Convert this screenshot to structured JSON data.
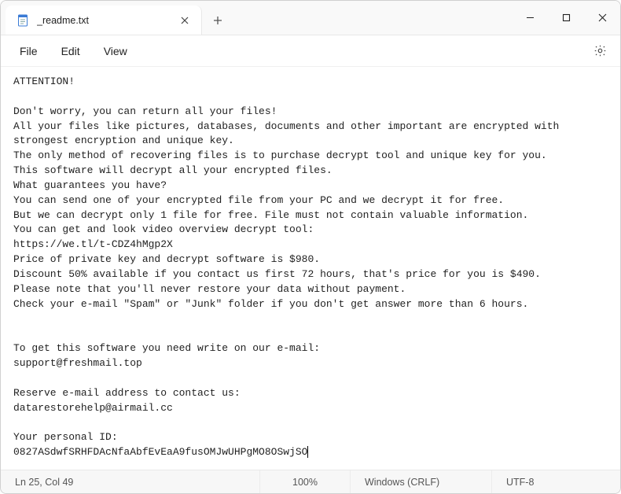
{
  "titlebar": {
    "tab_title": "_readme.txt"
  },
  "menubar": {
    "file": "File",
    "edit": "Edit",
    "view": "View"
  },
  "document": {
    "text": "ATTENTION!\n\nDon't worry, you can return all your files!\nAll your files like pictures, databases, documents and other important are encrypted with strongest encryption and unique key.\nThe only method of recovering files is to purchase decrypt tool and unique key for you.\nThis software will decrypt all your encrypted files.\nWhat guarantees you have?\nYou can send one of your encrypted file from your PC and we decrypt it for free.\nBut we can decrypt only 1 file for free. File must not contain valuable information.\nYou can get and look video overview decrypt tool:\nhttps://we.tl/t-CDZ4hMgp2X\nPrice of private key and decrypt software is $980.\nDiscount 50% available if you contact us first 72 hours, that's price for you is $490.\nPlease note that you'll never restore your data without payment.\nCheck your e-mail \"Spam\" or \"Junk\" folder if you don't get answer more than 6 hours.\n\n\nTo get this software you need write on our e-mail:\nsupport@freshmail.top\n\nReserve e-mail address to contact us:\ndatarestorehelp@airmail.cc\n\nYour personal ID:\n0827ASdwfSRHFDAcNfaAbfEvEaA9fusOMJwUHPgMO8OSwjSO"
  },
  "statusbar": {
    "position": "Ln 25, Col 49",
    "zoom": "100%",
    "line_ending": "Windows (CRLF)",
    "encoding": "UTF-8"
  }
}
